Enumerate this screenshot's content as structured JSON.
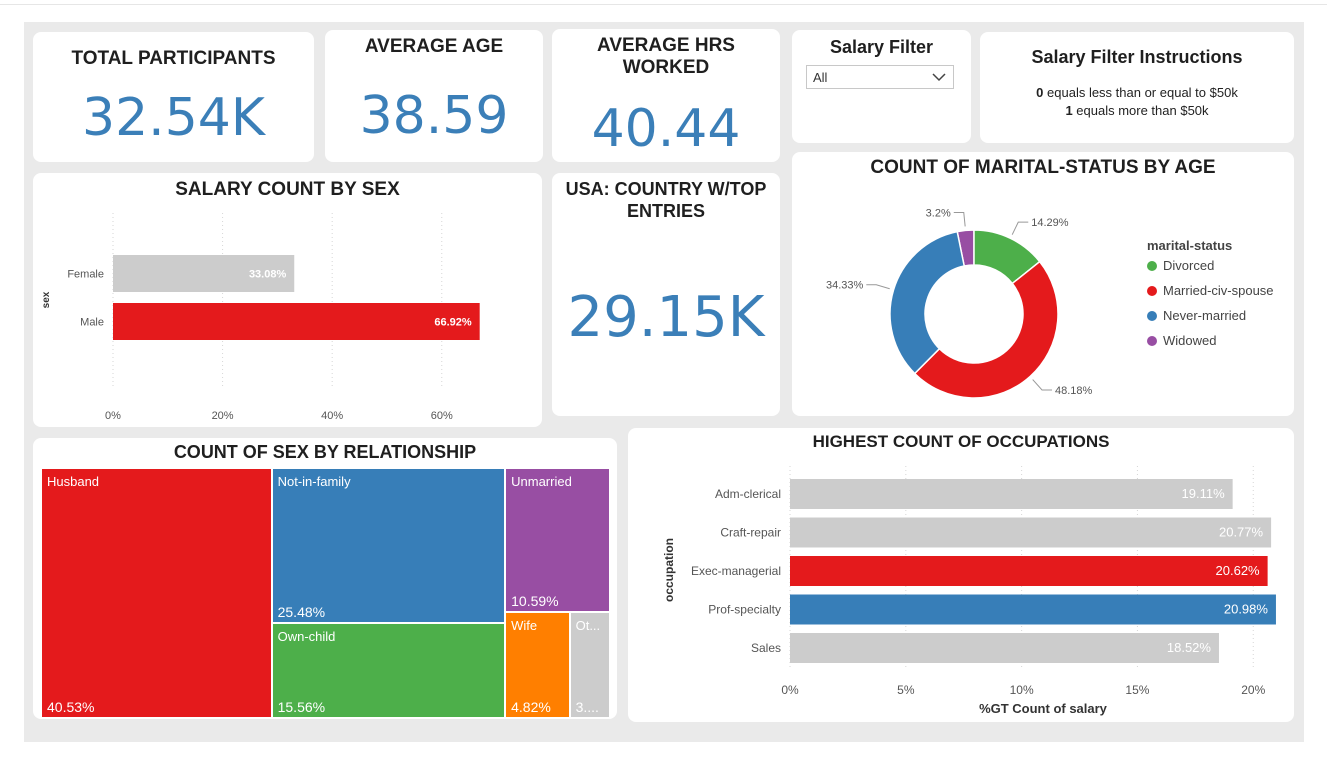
{
  "kpis": {
    "total_participants": {
      "title": "TOTAL PARTICIPANTS",
      "value": "32.54K"
    },
    "average_age": {
      "title": "AVERAGE AGE",
      "value": "38.59"
    },
    "average_hrs": {
      "title_line1": "AVERAGE HRS",
      "title_line2": "WORKED",
      "value": "40.44"
    },
    "usa": {
      "title_line1": "USA: COUNTRY W/TOP",
      "title_line2": "ENTRIES",
      "value": "29.15K"
    }
  },
  "salary_filter": {
    "title": "Salary Filter",
    "selected": "All"
  },
  "instructions": {
    "title": "Salary Filter Instructions",
    "line1_bold": "0",
    "line1_text": " equals less than or equal to $50k",
    "line2_bold": "1",
    "line2_text": " equals more than $50k"
  },
  "colors": {
    "red": "#e41a1c",
    "blue": "#377eb8",
    "green": "#4daf4a",
    "purple": "#984ea3",
    "orange": "#ff7f00",
    "gray": "#cccccc",
    "kpi_blue": "#3b7fb8"
  },
  "chart_data": [
    {
      "id": "salary_by_sex",
      "type": "bar",
      "orientation": "horizontal",
      "title": "SALARY COUNT BY SEX",
      "xlabel": "%GT Count of salary",
      "ylabel": "sex",
      "categories": [
        "Female",
        "Male"
      ],
      "values": [
        33.08,
        66.92
      ],
      "value_labels": [
        "33.08%",
        "66.92%"
      ],
      "colors": [
        "#cccccc",
        "#e41a1c"
      ],
      "xticks": [
        "0%",
        "20%",
        "40%",
        "60%"
      ],
      "xtick_values": [
        0,
        20,
        40,
        60
      ],
      "xlim": [
        0,
        73
      ]
    },
    {
      "id": "marital_status",
      "type": "pie",
      "donut": true,
      "title": "COUNT OF MARITAL-STATUS BY AGE",
      "legend_title": "marital-status",
      "legend_position": "right",
      "categories": [
        "Divorced",
        "Married-civ-spouse",
        "Never-married",
        "Widowed"
      ],
      "values": [
        14.29,
        48.18,
        34.33,
        3.2
      ],
      "value_labels": [
        "14.29%",
        "48.18%",
        "34.33%",
        "3.2%"
      ],
      "colors": [
        "#4daf4a",
        "#e41a1c",
        "#377eb8",
        "#984ea3"
      ]
    },
    {
      "id": "sex_by_relationship",
      "type": "treemap",
      "title": "COUNT OF SEX BY RELATIONSHIP",
      "categories": [
        "Husband",
        "Not-in-family",
        "Own-child",
        "Unmarried",
        "Wife",
        "Ot..."
      ],
      "values": [
        40.53,
        25.48,
        15.56,
        10.59,
        4.82,
        3.02
      ],
      "value_labels": [
        "40.53%",
        "25.48%",
        "15.56%",
        "10.59%",
        "4.82%",
        "3...."
      ],
      "colors": [
        "#e41a1c",
        "#377eb8",
        "#4daf4a",
        "#984ea3",
        "#ff7f00",
        "#cccccc"
      ]
    },
    {
      "id": "occupations",
      "type": "bar",
      "orientation": "horizontal",
      "title": "HIGHEST COUNT OF OCCUPATIONS",
      "xlabel": "%GT Count of salary",
      "ylabel": "occupation",
      "categories": [
        "Adm-clerical",
        "Craft-repair",
        "Exec-managerial",
        "Prof-specialty",
        "Sales"
      ],
      "values": [
        19.11,
        20.77,
        20.62,
        20.98,
        18.52
      ],
      "value_labels": [
        "19.11%",
        "20.77%",
        "20.62%",
        "20.98%",
        "18.52%"
      ],
      "colors": [
        "#cccccc",
        "#cccccc",
        "#e41a1c",
        "#377eb8",
        "#cccccc"
      ],
      "xticks": [
        "0%",
        "5%",
        "10%",
        "15%",
        "20%"
      ],
      "xtick_values": [
        0,
        5,
        10,
        15,
        20
      ],
      "xlim": [
        0,
        21.5
      ]
    }
  ]
}
